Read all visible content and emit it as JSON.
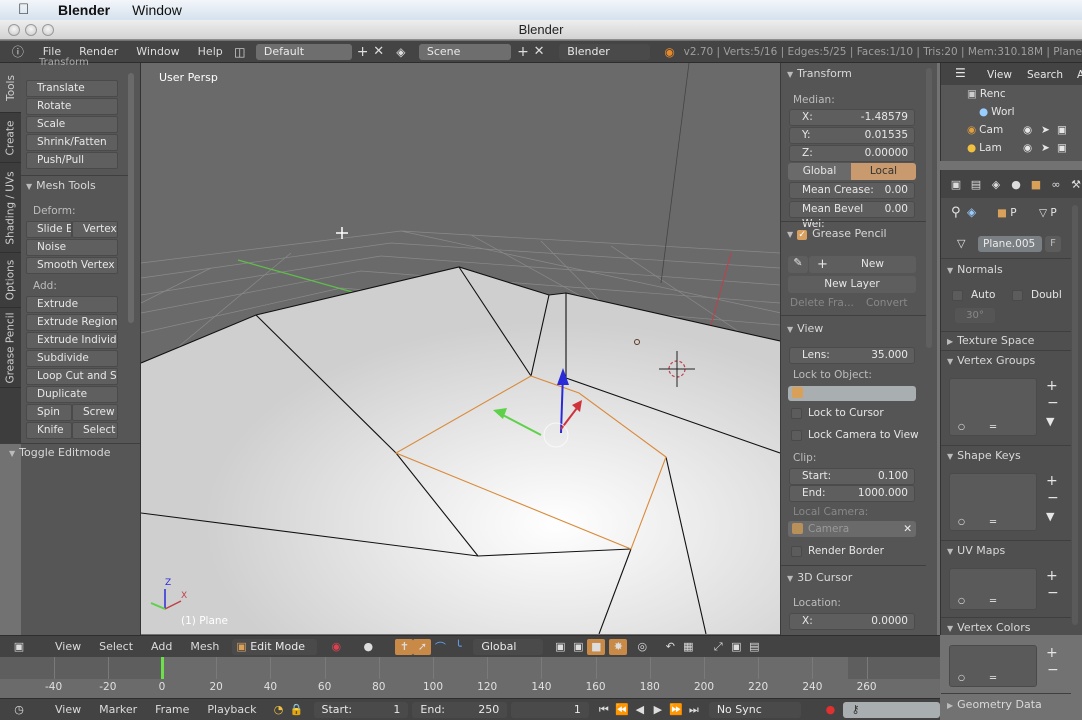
{
  "mac_menubar": {
    "app_name": "Blender",
    "menus": [
      "Window"
    ]
  },
  "window": {
    "title": "Blender"
  },
  "info_header": {
    "menus": [
      "File",
      "Render",
      "Window",
      "Help"
    ],
    "screen_layout": "Default",
    "scene": "Scene",
    "render_engine": "Blender Render",
    "stats": "v2.70 | Verts:5/16 | Edges:5/25 | Faces:1/10 | Tris:20 | Mem:310.18M | Plane"
  },
  "tool_tabs": [
    "Tools",
    "Create",
    "Shading / UVs",
    "Options",
    "Grease Pencil"
  ],
  "tool_shelf": {
    "transform_header": "Transform",
    "transform_buttons": [
      "Translate",
      "Rotate",
      "Scale",
      "Shrink/Fatten",
      "Push/Pull"
    ],
    "mesh_tools_header": "Mesh Tools",
    "deform_label": "Deform:",
    "deform_row": [
      "Slide E",
      "Vertex"
    ],
    "deform_buttons": [
      "Noise",
      "Smooth Vertex"
    ],
    "add_label": "Add:",
    "add_buttons": [
      "Extrude",
      "Extrude Region",
      "Extrude Individ...",
      "Subdivide",
      "Loop Cut and Sl...",
      "Duplicate"
    ],
    "spin_row": [
      "Spin",
      "Screw"
    ],
    "knife_row": [
      "Knife",
      "Select"
    ],
    "toggle_editmode": "Toggle Editmode"
  },
  "viewport": {
    "view_label": "User Persp",
    "object_label": "(1) Plane",
    "axis_labels": {
      "x": "X",
      "z": "Z"
    }
  },
  "n_panel": {
    "transform": {
      "header": "Transform",
      "median_label": "Median:",
      "x_label": "X:",
      "x_value": "-1.48579",
      "y_label": "Y:",
      "y_value": "0.01535",
      "z_label": "Z:",
      "z_value": "0.00000",
      "global_label": "Global",
      "local_label": "Local",
      "mean_crease_label": "Mean Crease:",
      "mean_crease_value": "0.00",
      "mean_bevel_label": "Mean Bevel Wei:",
      "mean_bevel_value": "0.00"
    },
    "grease_pencil": {
      "header": "Grease Pencil",
      "enabled": true,
      "new_label": "New",
      "new_layer_label": "New Layer",
      "delete_frame_label": "Delete Fra...",
      "convert_label": "Convert"
    },
    "view": {
      "header": "View",
      "lens_label": "Lens:",
      "lens_value": "35.000",
      "lock_to_object_label": "Lock to Object:",
      "lock_to_cursor_label": "Lock to Cursor",
      "lock_camera_label": "Lock Camera to View",
      "clip_label": "Clip:",
      "clip_start_label": "Start:",
      "clip_start_value": "0.100",
      "clip_end_label": "End:",
      "clip_end_value": "1000.000",
      "local_camera_label": "Local Camera:",
      "local_camera_value": "Camera",
      "render_border_label": "Render Border"
    },
    "cursor": {
      "header": "3D Cursor",
      "location_label": "Location:",
      "x_label": "X:",
      "x_value": "0.0000"
    }
  },
  "outliner": {
    "menus": [
      "View",
      "Search",
      "A"
    ],
    "items": [
      "Renc",
      "Worl",
      "Cam",
      "Lam"
    ]
  },
  "properties": {
    "tab_labels": [
      "P",
      "P"
    ],
    "mesh_name": "Plane.005",
    "fake_user": "F",
    "normals_header": "Normals",
    "auto_label": "Auto",
    "double_label": "Doubl",
    "angle_value": "30°",
    "texture_space_header": "Texture Space",
    "vertex_groups_header": "Vertex Groups",
    "shape_keys_header": "Shape Keys",
    "uv_maps_header": "UV Maps",
    "vertex_colors_header": "Vertex Colors",
    "geometry_data_header": "Geometry Data"
  },
  "view3d_header": {
    "menus": [
      "View",
      "Select",
      "Add",
      "Mesh"
    ],
    "mode": "Edit Mode",
    "orientation": "Global"
  },
  "timeline": {
    "ticks": [
      "-40",
      "-20",
      "0",
      "20",
      "40",
      "60",
      "80",
      "100",
      "120",
      "140",
      "160",
      "180",
      "200",
      "220",
      "240",
      "260"
    ],
    "current_frame": "1",
    "menus": [
      "View",
      "Marker",
      "Frame",
      "Playback"
    ],
    "start_label": "Start:",
    "start_value": "1",
    "end_label": "End:",
    "end_value": "250",
    "frame_value": "1",
    "sync": "No Sync"
  },
  "colors": {
    "accent": "#c98a47",
    "x_axis": "#d0323c",
    "y_axis": "#5ed04a",
    "z_axis": "#2a2ad8",
    "selected_edge": "#d98a3a"
  }
}
